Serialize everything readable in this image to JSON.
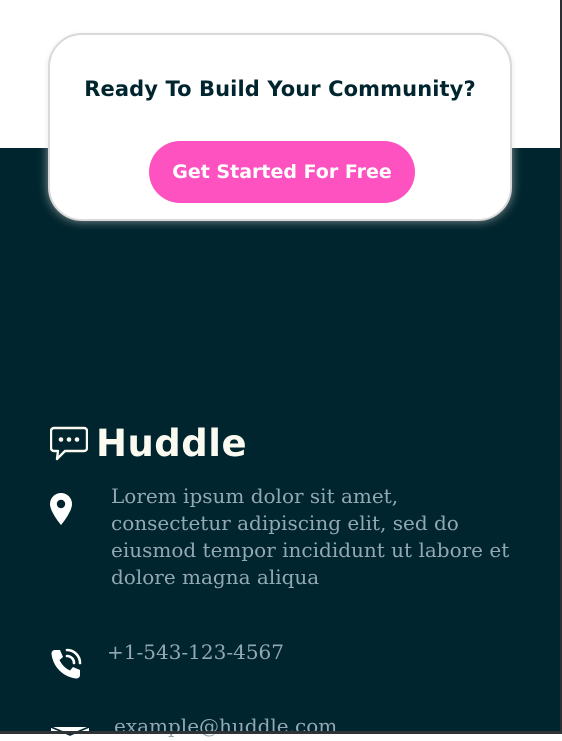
{
  "cta": {
    "title": "Ready To Build Your Community?",
    "button_label": "Get Started For Free",
    "button_color": "#ff52c1"
  },
  "footer": {
    "background_color": "#00252e",
    "brand": {
      "name": "Huddle",
      "icon": "chat-bubble-icon"
    },
    "contact": {
      "address": "Lorem ipsum dolor sit amet, consectetur adipiscing elit, sed do eiusmod tempor incididunt ut labore et dolore magna aliqua",
      "address_icon": "location-pin-icon",
      "phone": "+1-543-123-4567",
      "phone_icon": "phone-icon",
      "email": "example@huddle.com",
      "email_icon": "mail-icon"
    }
  }
}
